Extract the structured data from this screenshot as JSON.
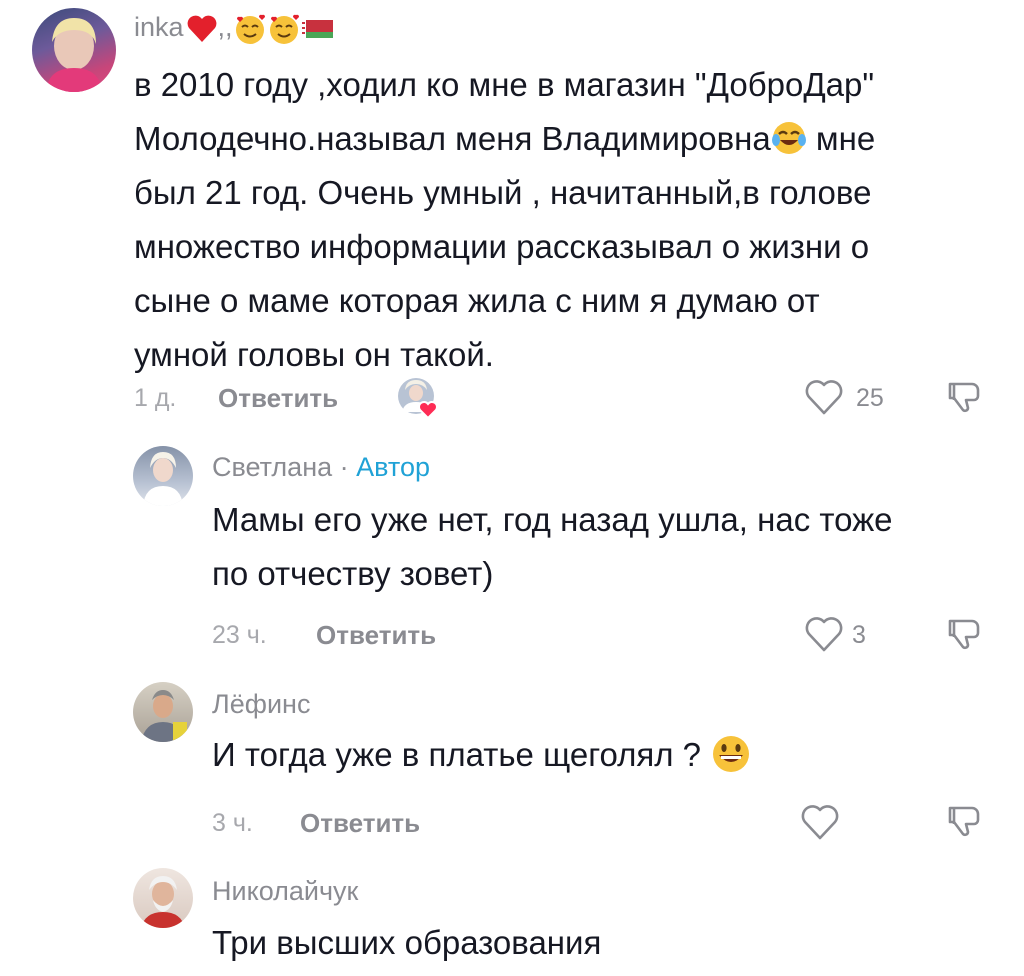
{
  "comments": [
    {
      "username": "inka",
      "username_suffix": ",,",
      "text_lines": [
        "в 2010 году ,ходил ко мне в магазин \"ДоброДар\"",
        "Молодечно.называл меня Владимировна",
        " мне",
        "был 21 год. Очень умный , начитанный,в голове",
        "множество информации рассказывал о жизни о",
        "сыне о маме которая жила с ним я думаю от",
        "умной головы он такой."
      ],
      "time": "1 д.",
      "reply_label": "Ответить",
      "likes": "25"
    },
    {
      "username": "Светлана",
      "separator": " · ",
      "author_label": "Автор",
      "text_lines": [
        "Мамы его уже нет, год назад ушла, нас тоже",
        "по отчеству зовет)"
      ],
      "time": "23 ч.",
      "reply_label": "Ответить",
      "likes": "3"
    },
    {
      "username": "Лёфинс",
      "text_lines": [
        "И тогда уже в платье щеголял ? "
      ],
      "time": "3 ч.",
      "reply_label": "Ответить",
      "likes": ""
    },
    {
      "username": "Николайчук",
      "text_lines": [
        "Три высших образования"
      ]
    }
  ],
  "icons": {
    "like": "heart-outline-icon",
    "dislike": "thumbs-down-icon",
    "creator_liked": "creator-avatar-heart-icon"
  },
  "colors": {
    "author": "#20a2d6",
    "text": "#161823",
    "muted": "#8a8b91",
    "heart": "#fe2c55"
  }
}
